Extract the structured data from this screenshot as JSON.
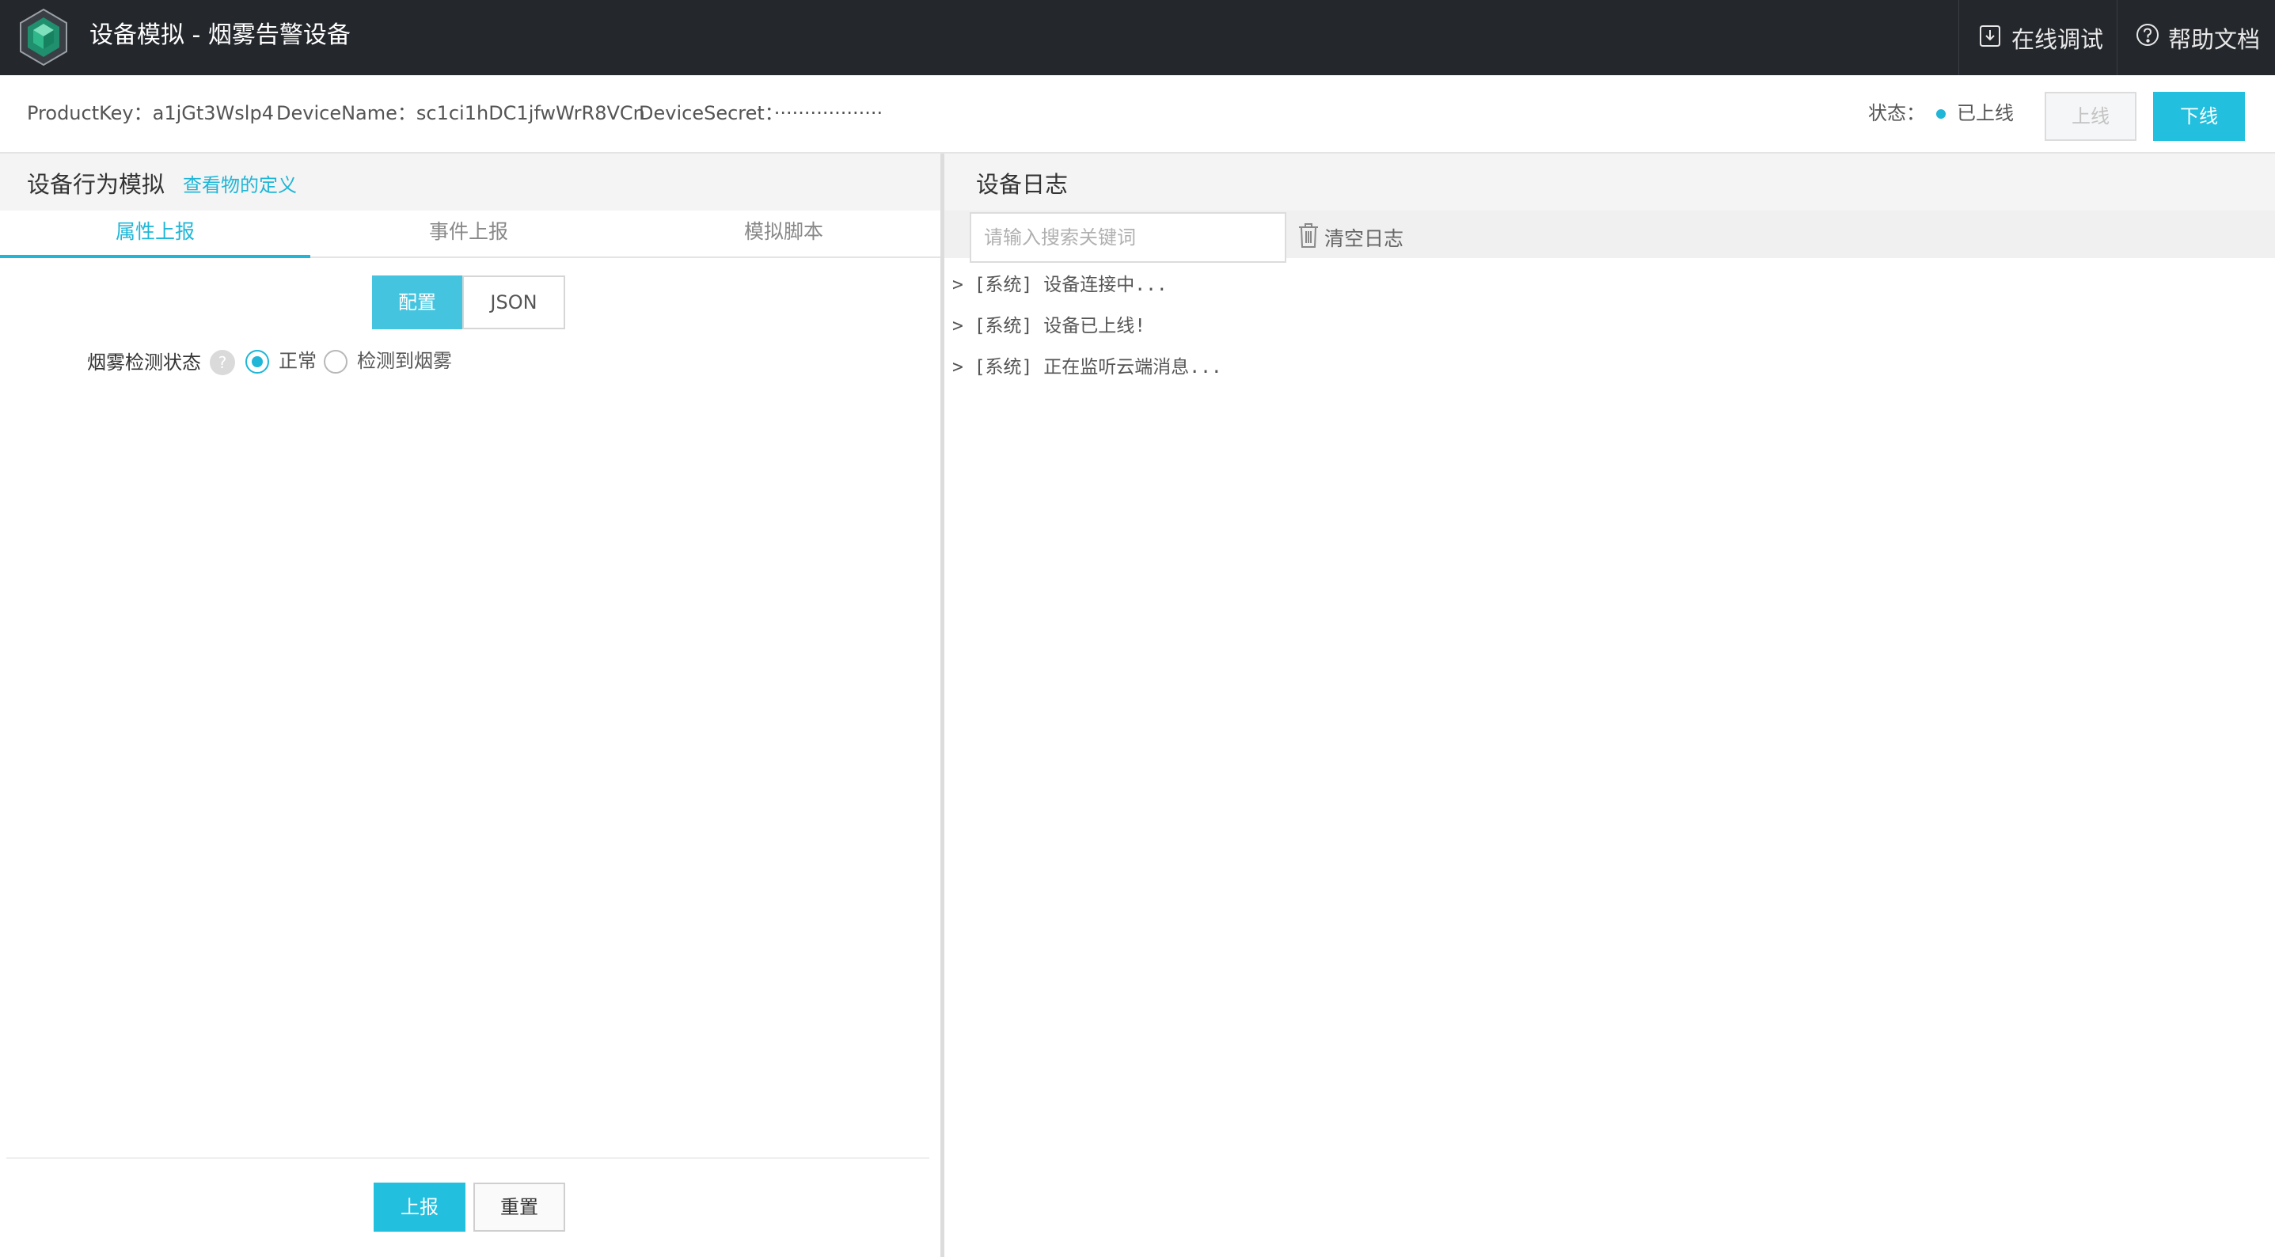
{
  "header": {
    "title": "设备模拟 - 烟雾告警设备",
    "debug_label": "在线调试",
    "help_label": "帮助文档"
  },
  "device_info": {
    "product_key": "ProductKey：a1jGt3Wslp4",
    "device_name": "DeviceName：sc1ci1hDC1jfwWrR8VCn",
    "device_secret": "DeviceSecret：··················",
    "status_label": "状态：",
    "status_value": "已上线",
    "online_button": "上线",
    "offline_button": "下线"
  },
  "left_panel": {
    "title": "设备行为模拟",
    "view_definition_link": "查看物的定义",
    "tabs": [
      {
        "label": "属性上报",
        "active": true
      },
      {
        "label": "事件上报",
        "active": false
      },
      {
        "label": "模拟脚本",
        "active": false
      }
    ],
    "mode_toggle": {
      "config": "配置",
      "json": "JSON"
    },
    "field": {
      "label": "烟雾检测状态",
      "help": "?",
      "options": [
        {
          "label": "正常",
          "checked": true
        },
        {
          "label": "检测到烟雾",
          "checked": false
        }
      ]
    },
    "report_button": "上报",
    "reset_button": "重置"
  },
  "right_panel": {
    "title": "设备日志",
    "search_placeholder": "请输入搜索关键词",
    "clear_log_label": "清空日志",
    "logs": [
      "> [系统] 设备连接中...",
      "> [系统] 设备已上线!",
      "> [系统] 正在监听云端消息..."
    ]
  },
  "colors": {
    "accent": "#1fb6d7",
    "topbar": "#24272c"
  },
  "icons": {
    "logo": "hexagon-cube-logo",
    "debug": "download-box-icon",
    "help": "question-circle-icon",
    "clear": "trash-icon"
  }
}
